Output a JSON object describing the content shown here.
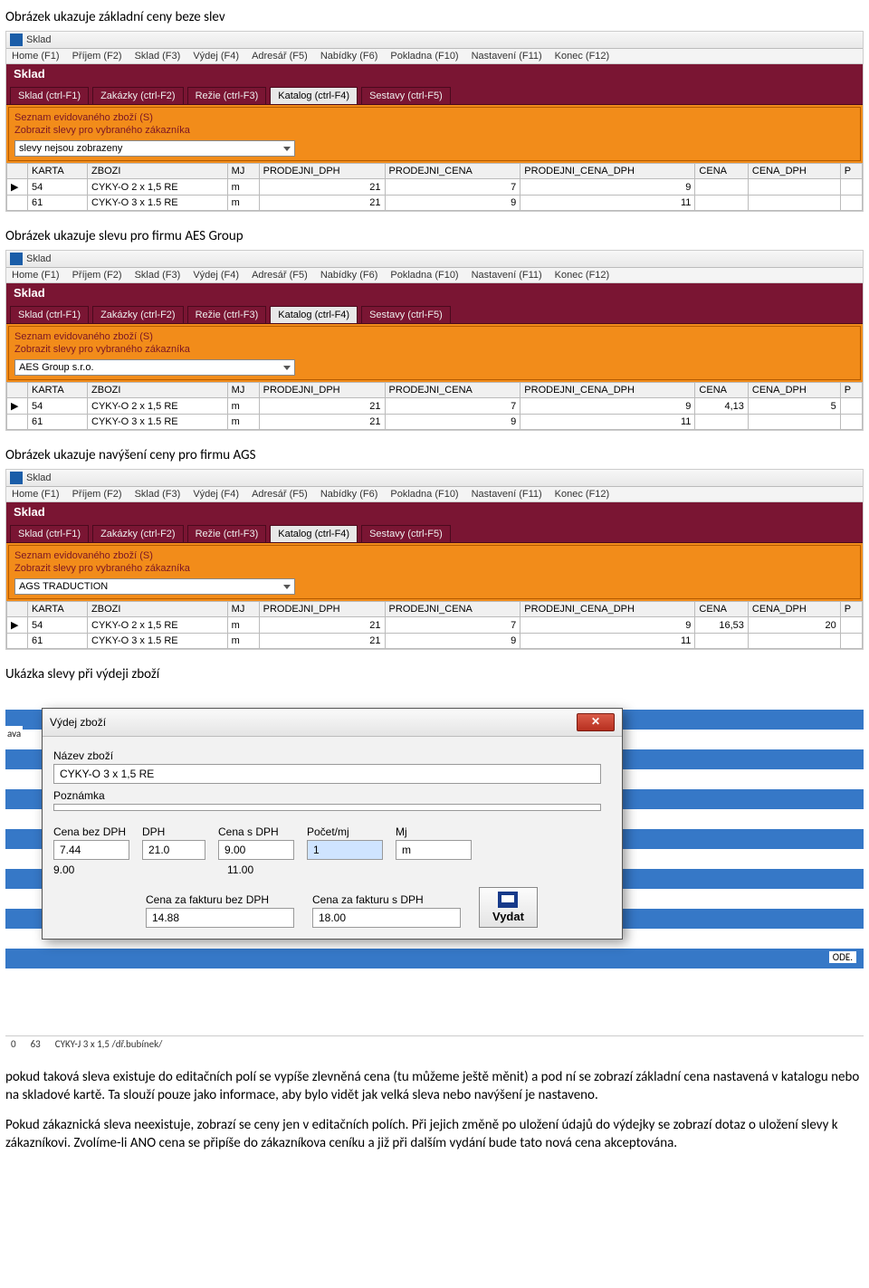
{
  "paragraphs": {
    "p1": "Obrázek ukazuje základní ceny beze slev",
    "p2": "Obrázek ukazuje slevu pro firmu AES Group",
    "p3": "Obrázek ukazuje navýšení ceny pro firmu AGS",
    "p4": "Ukázka slevy při výdeji zboží",
    "p5": "pokud taková sleva existuje do editačních polí se vypíše zlevněná cena (tu můžeme ještě měnit) a pod ní se zobrazí základní cena nastavená v katalogu nebo na skladové kartě. Ta slouží pouze jako informace, aby bylo vidět jak velká sleva nebo navýšení je nastaveno.",
    "p6": "Pokud zákaznická sleva neexistuje, zobrazí se ceny jen v editačních polích. Při jejich změně po uložení údajů do výdejky se zobrazí dotaz o uložení slevy k zákazníkovi. Zvolíme-li ANO cena se připíše do zákazníkova ceníku a již při dalším vydání bude tato nová cena akceptována."
  },
  "app": {
    "title": "Sklad",
    "menu": [
      "Home (F1)",
      "Příjem (F2)",
      "Sklad (F3)",
      "Výdej (F4)",
      "Adresář (F5)",
      "Nabídky (F6)",
      "Pokladna (F10)",
      "Nastavení (F11)",
      "Konec (F12)"
    ],
    "section": "Sklad",
    "tabs": [
      "Sklad (ctrl-F1)",
      "Zakázky (ctrl-F2)",
      "Režie (ctrl-F3)",
      "Katalog (ctrl-F4)",
      "Sestavy (ctrl-F5)"
    ],
    "panel_line1": "Seznam evidovaného zboží (S)",
    "panel_line2": "Zobrazit slevy pro vybraného zákazníka",
    "headers": [
      "KARTA",
      "ZBOZI",
      "MJ",
      "PRODEJNI_DPH",
      "PRODEJNI_CENA",
      "PRODEJNI_CENA_DPH",
      "CENA",
      "CENA_DPH",
      "P"
    ]
  },
  "shot1": {
    "combo": "slevy nejsou zobrazeny",
    "rows": [
      {
        "k": "54",
        "z": "CYKY-O 2 x 1,5 RE",
        "mj": "m",
        "dph": "21",
        "pc": "7",
        "pcd": "9",
        "c": "",
        "cd": ""
      },
      {
        "k": "61",
        "z": "CYKY-O 3 x 1.5 RE",
        "mj": "m",
        "dph": "21",
        "pc": "9",
        "pcd": "11",
        "c": "",
        "cd": ""
      }
    ]
  },
  "shot2": {
    "combo": "AES Group s.r.o.",
    "rows": [
      {
        "k": "54",
        "z": "CYKY-O 2 x 1,5 RE",
        "mj": "m",
        "dph": "21",
        "pc": "7",
        "pcd": "9",
        "c": "4,13",
        "cd": "5"
      },
      {
        "k": "61",
        "z": "CYKY-O 3 x 1.5 RE",
        "mj": "m",
        "dph": "21",
        "pc": "9",
        "pcd": "11",
        "c": "",
        "cd": ""
      }
    ]
  },
  "shot3": {
    "combo": "AGS TRADUCTION",
    "rows": [
      {
        "k": "54",
        "z": "CYKY-O 2 x 1,5 RE",
        "mj": "m",
        "dph": "21",
        "pc": "7",
        "pcd": "9",
        "c": "16,53",
        "cd": "20"
      },
      {
        "k": "61",
        "z": "CYKY-O 3 x 1.5 RE",
        "mj": "m",
        "dph": "21",
        "pc": "9",
        "pcd": "11",
        "c": "",
        "cd": ""
      }
    ]
  },
  "dialog": {
    "title": "Výdej zboží",
    "lbl_name": "Název zboží",
    "val_name": "CYKY-O 3 x 1,5 RE",
    "lbl_note": "Poznámka",
    "val_note": "",
    "lbl_bez": "Cena bez DPH",
    "lbl_dph": "DPH",
    "lbl_s": "Cena s DPH",
    "lbl_pocet": "Počet/mj",
    "lbl_mj": "Mj",
    "v_bez": "7.44",
    "v_dph": "21.0",
    "v_s": "9.00",
    "v_pocet": "1",
    "v_mj": "m",
    "u_bez": "9.00",
    "u_s": "11.00",
    "lbl_fbez": "Cena za fakturu bez DPH",
    "lbl_fs": "Cena za fakturu s DPH",
    "v_fbez": "14.88",
    "v_fs": "18.00",
    "btn": "Vydat",
    "ode": "ODE.",
    "bg_row": {
      "a": "0",
      "b": "63",
      "c": "CYKY-J 3 x 1,5 /dř.bubínek/"
    },
    "ava": "ava"
  }
}
